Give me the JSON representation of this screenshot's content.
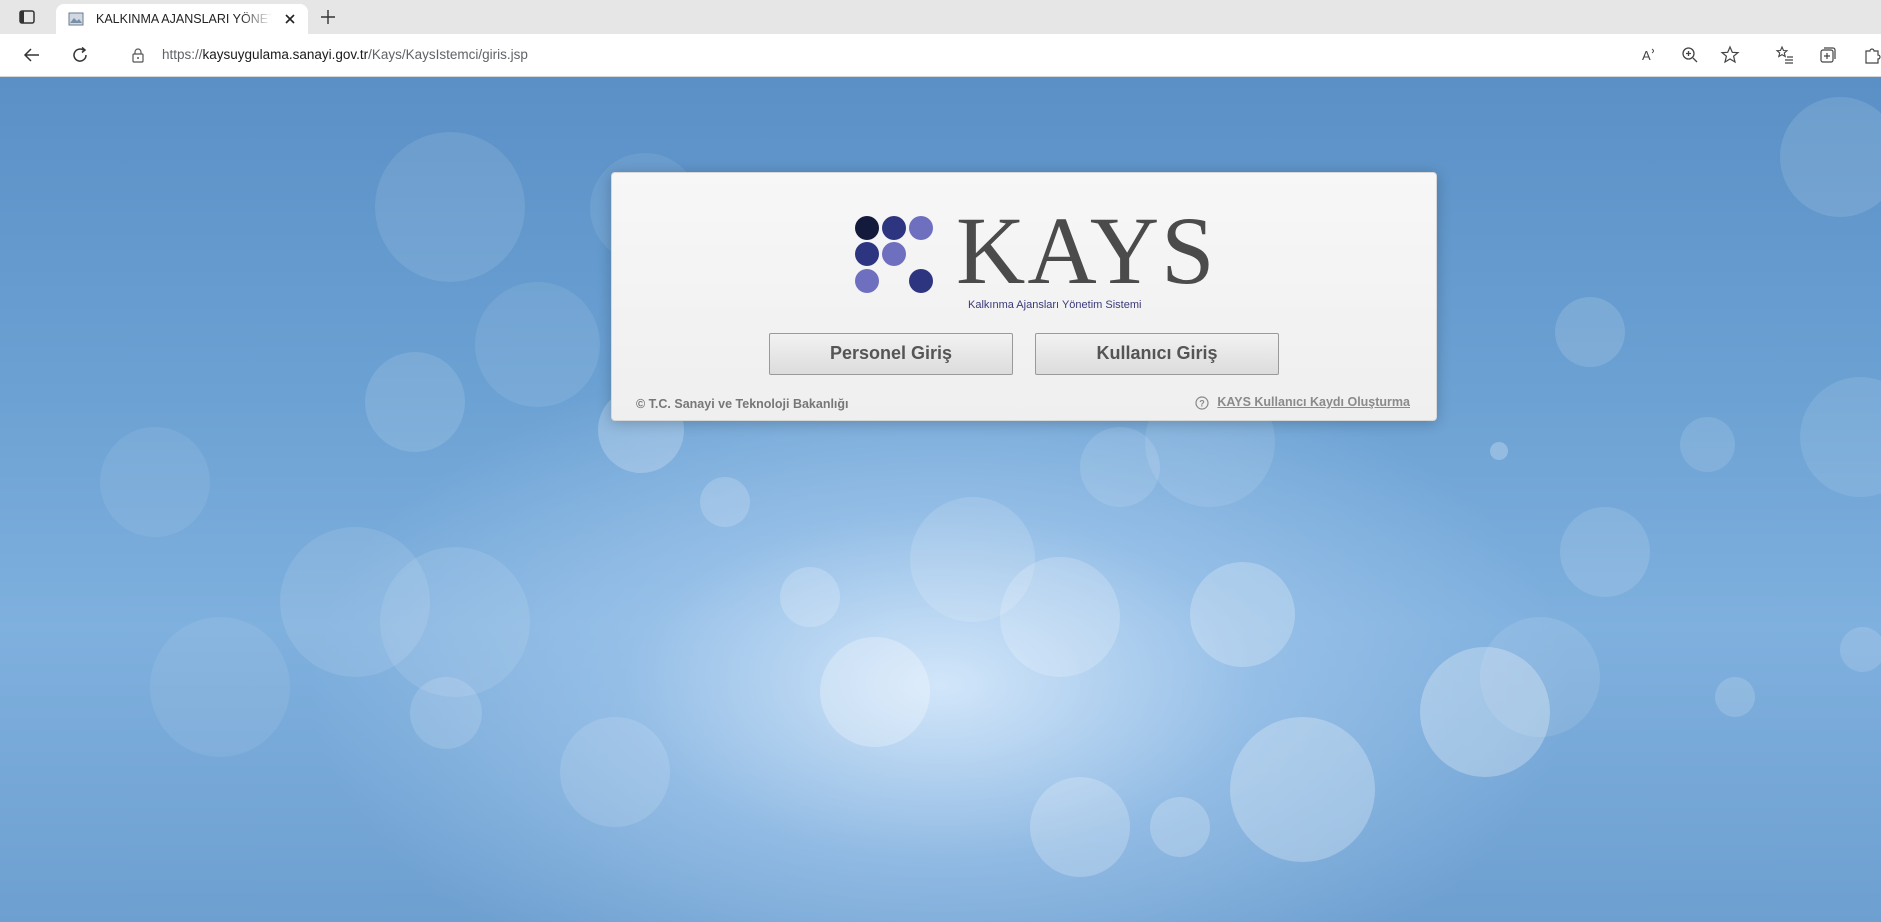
{
  "browser": {
    "tab_title": "KALKINMA AJANSLARI YÖNETİM",
    "url_prefix": "https://",
    "url_domain": "kaysuygulama.sanayi.gov.tr",
    "url_path": "/Kays/KaysIstemci/giris.jsp",
    "icons": {
      "tab_actions": "tab-actions-icon",
      "favicon": "favicon-icon",
      "close": "close-icon",
      "new_tab": "plus-icon",
      "back": "back-arrow-icon",
      "refresh": "refresh-icon",
      "lock": "lock-icon",
      "read_aloud": "read-aloud-icon",
      "zoom": "zoom-icon",
      "favorite": "star-icon",
      "favorites": "favorites-list-icon",
      "collections": "collections-icon",
      "extensions": "extensions-icon"
    }
  },
  "login": {
    "logo_text": "KAYS",
    "logo_subtitle": "Kalkınma Ajansları Yönetim Sistemi",
    "personnel_button": "Personel Giriş",
    "user_button": "Kullanıcı Giriş",
    "copyright": "© T.C. Sanayi ve Teknoloji Bakanlığı",
    "register_link": "KAYS Kullanıcı Kaydı Oluşturma"
  },
  "colors": {
    "logo_dot_dark": "#141a3c",
    "logo_dot_navy": "#2e3580",
    "logo_dot_light": "#6e70bf",
    "background_blue": "#5b8fc4"
  }
}
